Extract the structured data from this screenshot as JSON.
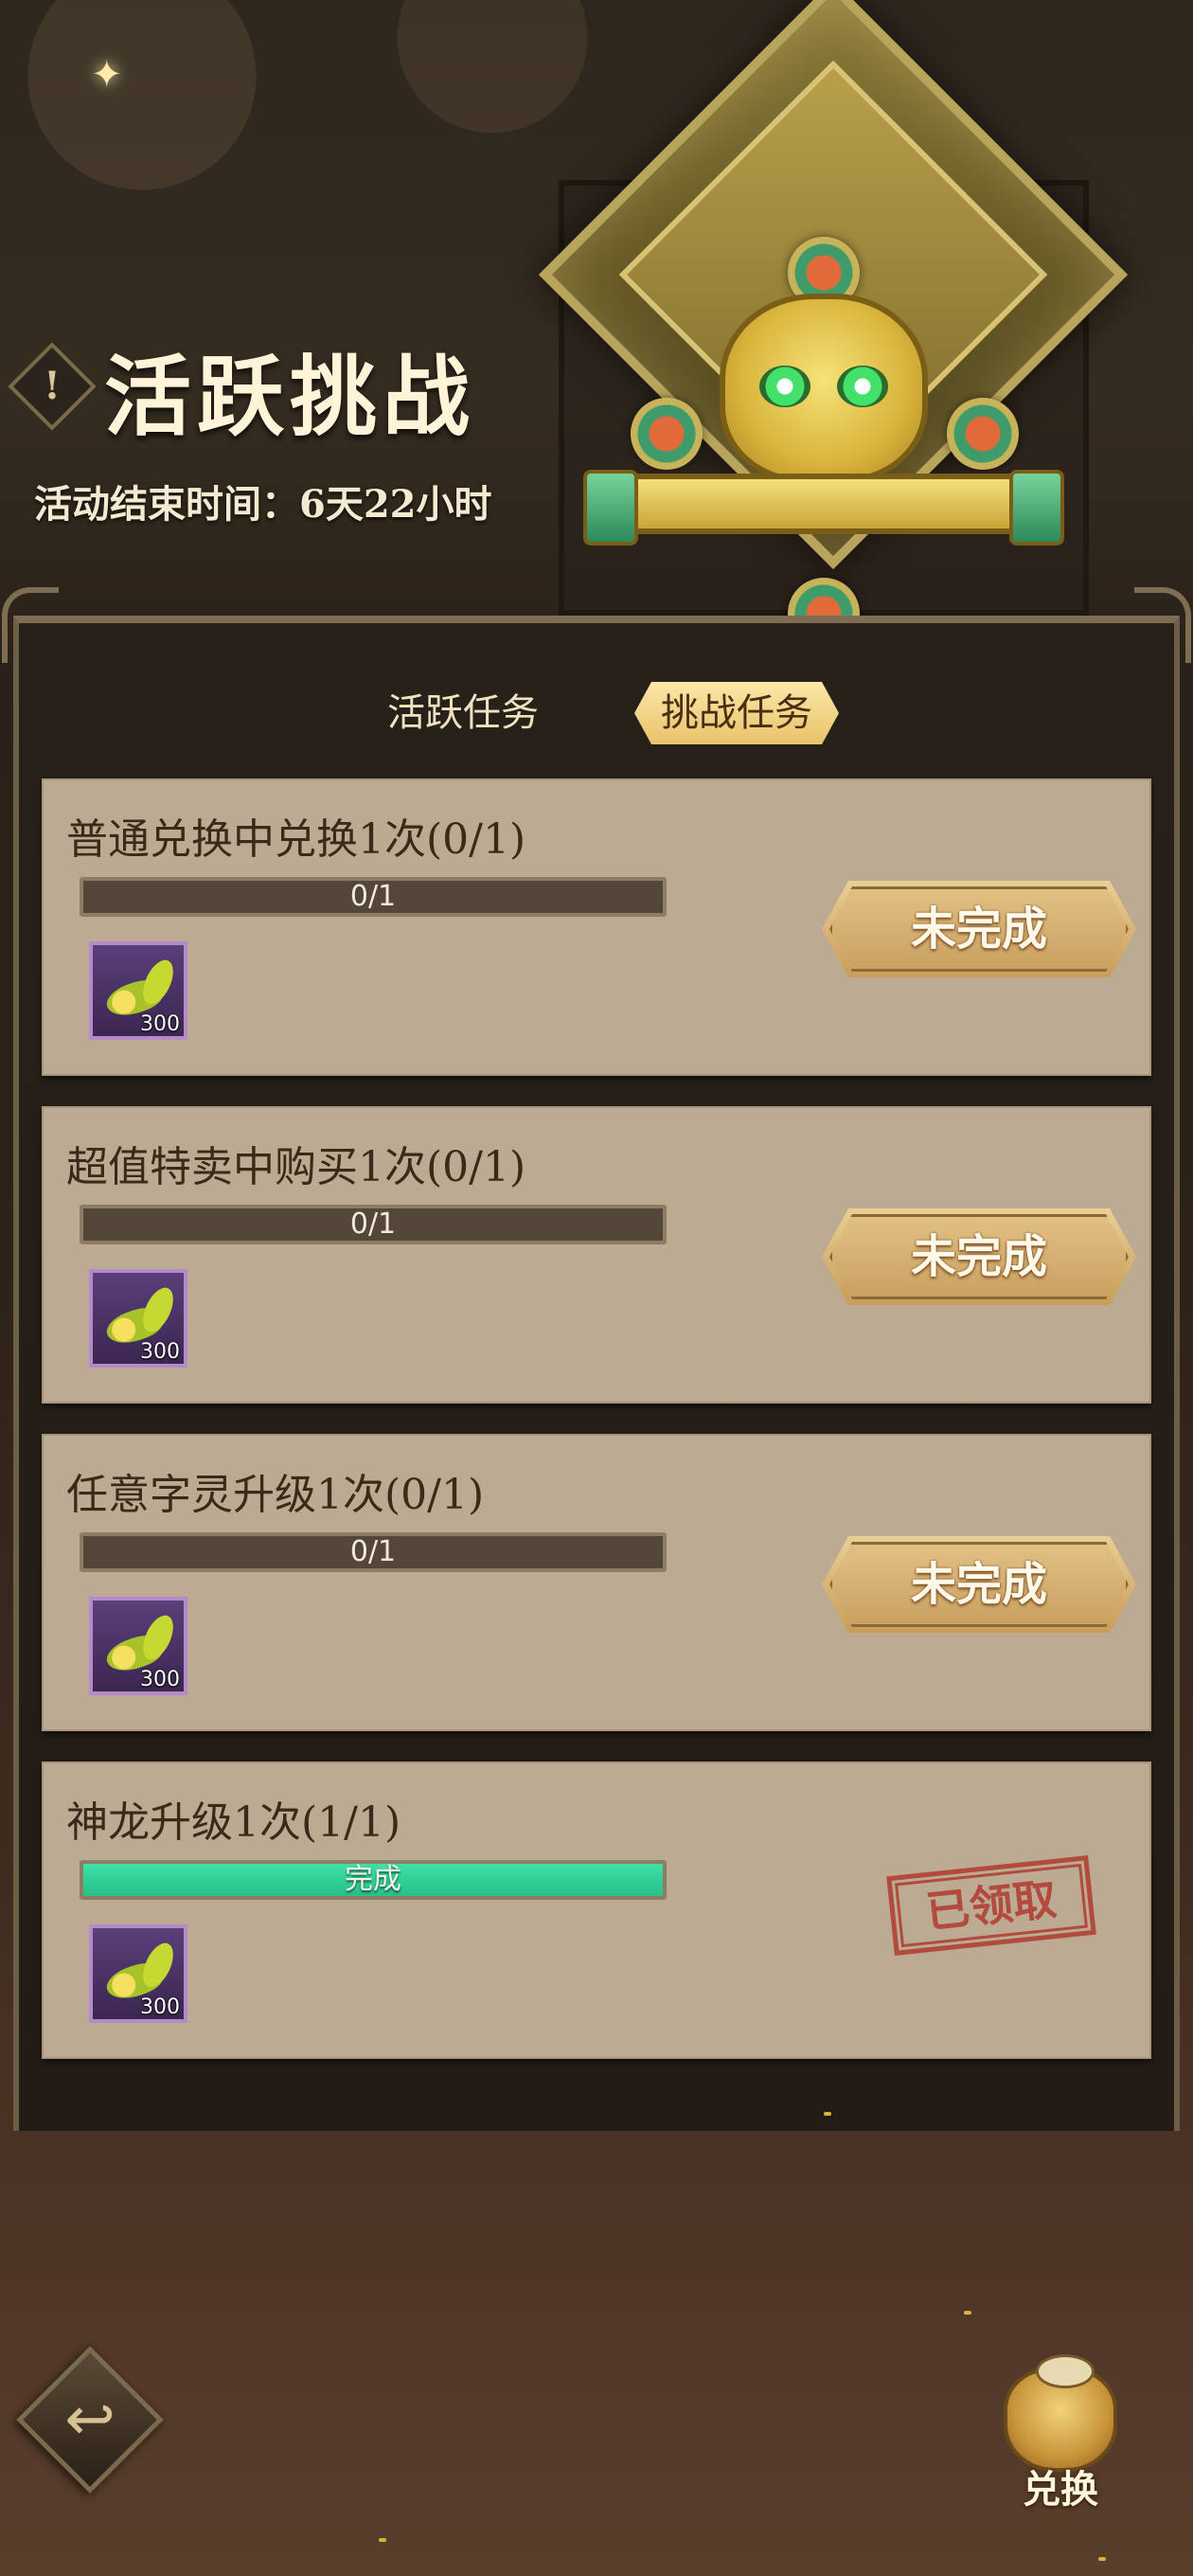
{
  "header": {
    "title": "活跃挑战",
    "subtitle": "活动结束时间：6天22小时",
    "warn_icon_char": "!"
  },
  "tabs": [
    {
      "label": "活跃任务",
      "active": false
    },
    {
      "label": "挑战任务",
      "active": true
    }
  ],
  "tasks": [
    {
      "title": "普通兑换中兑换1次(0/1)",
      "progress_text": "0/1",
      "progress": 0,
      "reward_count": "300",
      "status": "未完成",
      "claimed": false
    },
    {
      "title": "超值特卖中购买1次(0/1)",
      "progress_text": "0/1",
      "progress": 0,
      "reward_count": "300",
      "status": "未完成",
      "claimed": false
    },
    {
      "title": "任意字灵升级1次(0/1)",
      "progress_text": "0/1",
      "progress": 0,
      "reward_count": "300",
      "status": "未完成",
      "claimed": false
    },
    {
      "title": "神龙升级1次(1/1)",
      "progress_text": "完成",
      "progress": 1,
      "reward_count": "300",
      "status": "已领取",
      "claimed": true
    }
  ],
  "footer": {
    "back_icon": "↩",
    "exchange_label": "兑换"
  },
  "colors": {
    "card_bg": "#bcab92",
    "progress_done": "#2fd49a",
    "stamp_red": "#b24034",
    "tab_active": "#f2d487"
  }
}
